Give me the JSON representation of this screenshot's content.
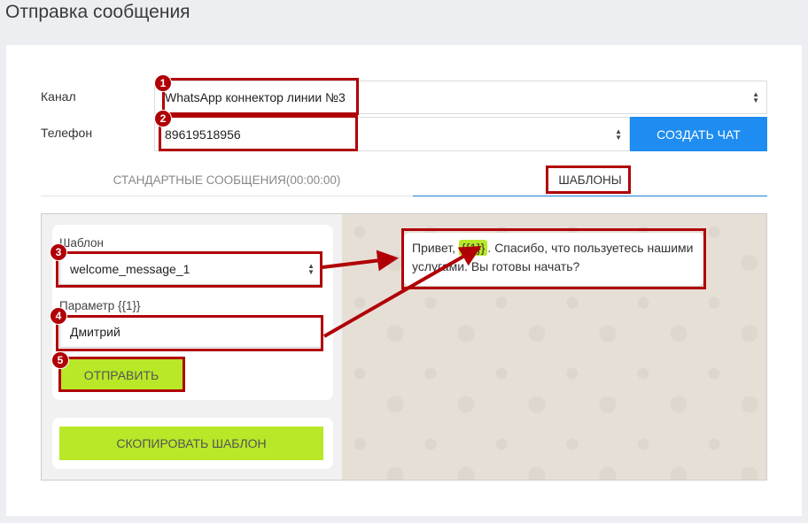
{
  "page": {
    "title": "Отправка сообщения"
  },
  "form": {
    "channel_label": "Канал",
    "channel_value": "WhatsApp коннектор линии №3",
    "phone_label": "Телефон",
    "phone_value": "89619518956",
    "create_chat_label": "СОЗДАТЬ ЧАТ"
  },
  "tabs": [
    {
      "label": "СТАНДАРТНЫЕ СООБЩЕНИЯ(00:00:00)",
      "active": false
    },
    {
      "label": "ШАБЛОНЫ",
      "active": true
    }
  ],
  "template_form": {
    "template_label": "Шаблон",
    "template_value": "welcome_message_1",
    "param_label": "Параметр {{1}}",
    "param_value": "Дмитрий",
    "send_label": "ОТПРАВИТЬ",
    "copy_label": "СКОПИРОВАТЬ ШАБЛОН"
  },
  "preview": {
    "text_before": "Привет, ",
    "placeholder": "{{1}}",
    "text_after": ". Спасибо, что пользуетесь нашими услугами. Вы готовы начать?"
  },
  "annotations": [
    "1",
    "2",
    "3",
    "4",
    "5"
  ],
  "colors": {
    "accent_blue": "#1e8cf0",
    "accent_green": "#b8e827",
    "annotation_red": "#b00006"
  }
}
